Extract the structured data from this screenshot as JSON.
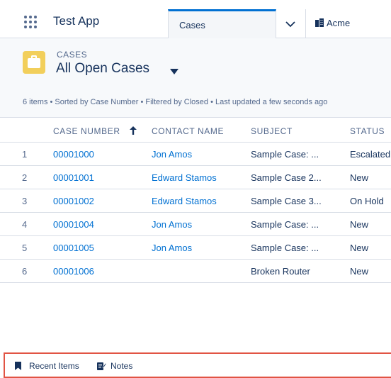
{
  "nav": {
    "app_name": "Test App",
    "tabs": [
      {
        "label": "Cases",
        "active": true
      },
      {
        "label": "Acme",
        "icon": "building-icon"
      }
    ]
  },
  "header": {
    "object_label": "CASES",
    "list_view_title": "All Open Cases",
    "meta": "6 items • Sorted by Case Number • Filtered by Closed • Last updated a few seconds ago",
    "icon": "briefcase-icon",
    "icon_color": "#f2cf5b"
  },
  "table": {
    "columns": [
      "CASE NUMBER",
      "CONTACT NAME",
      "SUBJECT",
      "STATUS"
    ],
    "sort_column": "CASE NUMBER",
    "rows": [
      {
        "num": "1",
        "case_number": "00001000",
        "contact": "Jon Amos",
        "subject": "Sample Case: ...",
        "status": "Escalated"
      },
      {
        "num": "2",
        "case_number": "00001001",
        "contact": "Edward Stamos",
        "subject": "Sample Case 2...",
        "status": "New"
      },
      {
        "num": "3",
        "case_number": "00001002",
        "contact": "Edward Stamos",
        "subject": "Sample Case 3...",
        "status": "On Hold"
      },
      {
        "num": "4",
        "case_number": "00001004",
        "contact": "Jon Amos",
        "subject": "Sample Case: ...",
        "status": "New"
      },
      {
        "num": "5",
        "case_number": "00001005",
        "contact": "Jon Amos",
        "subject": "Sample Case: ...",
        "status": "New"
      },
      {
        "num": "6",
        "case_number": "00001006",
        "contact": "",
        "subject": "Broken Router",
        "status": "New"
      }
    ]
  },
  "utility_bar": {
    "items": [
      {
        "label": "Recent Items",
        "icon": "bookmark-icon"
      },
      {
        "label": "Notes",
        "icon": "note-icon"
      }
    ],
    "highlight_color": "#e15444"
  },
  "colors": {
    "link": "#0070d2",
    "text": "#16325c",
    "muted": "#54698d",
    "active_tab_accent": "#0070d2"
  }
}
